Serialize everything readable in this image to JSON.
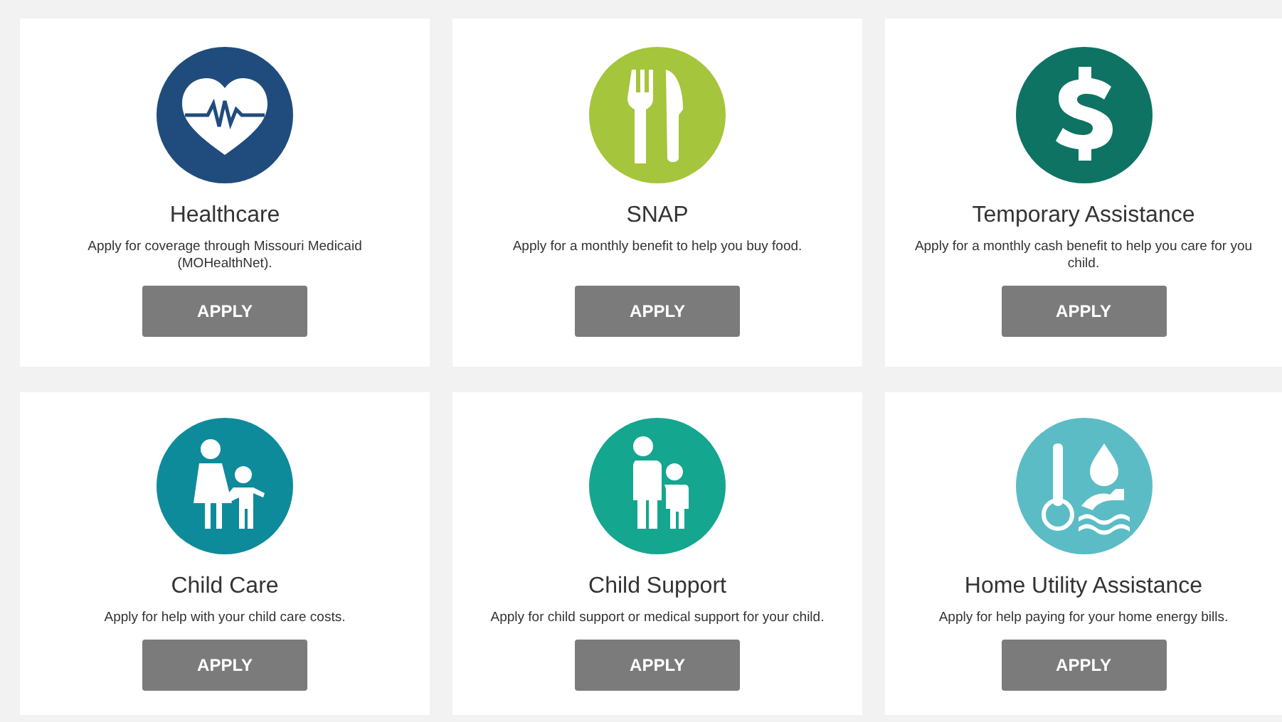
{
  "rows": [
    {
      "cards": [
        {
          "kind": "heart",
          "color": "#1f4c7c",
          "title": "Healthcare",
          "description": "Apply for coverage through Missouri Medicaid (MOHealthNet).",
          "button": "APPLY"
        },
        {
          "kind": "utensils",
          "color": "#a5c53c",
          "title": "SNAP",
          "description": "Apply for a monthly benefit to help you buy food.",
          "button": "APPLY"
        },
        {
          "kind": "dollar",
          "color": "#0e7363",
          "title": "Temporary Assistance",
          "description": "Apply for a monthly cash benefit to help you care for you child.",
          "button": "APPLY"
        }
      ]
    },
    {
      "cards": [
        {
          "kind": "adult-child",
          "color": "#0e8b9b",
          "title": "Child Care",
          "description": "Apply for help with your child care costs.",
          "button": "APPLY"
        },
        {
          "kind": "parent-child",
          "color": "#14a68f",
          "title": "Child Support",
          "description": "Apply for child support or medical support for your child.",
          "button": "APPLY"
        },
        {
          "kind": "utility",
          "color": "#5bbcc5",
          "title": "Home Utility Assistance",
          "description": "Apply for help paying for your home energy bills.",
          "button": "APPLY"
        }
      ]
    }
  ]
}
